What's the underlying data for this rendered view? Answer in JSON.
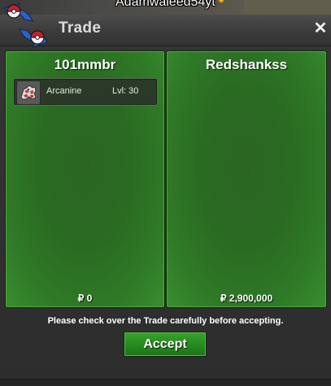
{
  "world": {
    "player_name": "Adamwaleed54yt"
  },
  "window": {
    "title": "Trade",
    "close_symbol": "✕",
    "logo_icon": "swap-pokeballs-icon"
  },
  "left_panel": {
    "trader_name": "101mmbr",
    "money": "₽ 0",
    "items": [
      {
        "name": "Arcanine",
        "level": "Lvl: 30",
        "icon": "arcanine-sprite-icon"
      }
    ]
  },
  "right_panel": {
    "trader_name": "Redshankss",
    "money": "₽ 2,900,000",
    "items": []
  },
  "notice": "Please check over the Trade carefully before accepting.",
  "accept_label": "Accept",
  "colors": {
    "panel_green": "#2c6625",
    "button_green": "#258a1e",
    "title_bg": "#3c3c3c",
    "logo_blue": "#2d62c0",
    "logo_red": "#c8202c"
  }
}
